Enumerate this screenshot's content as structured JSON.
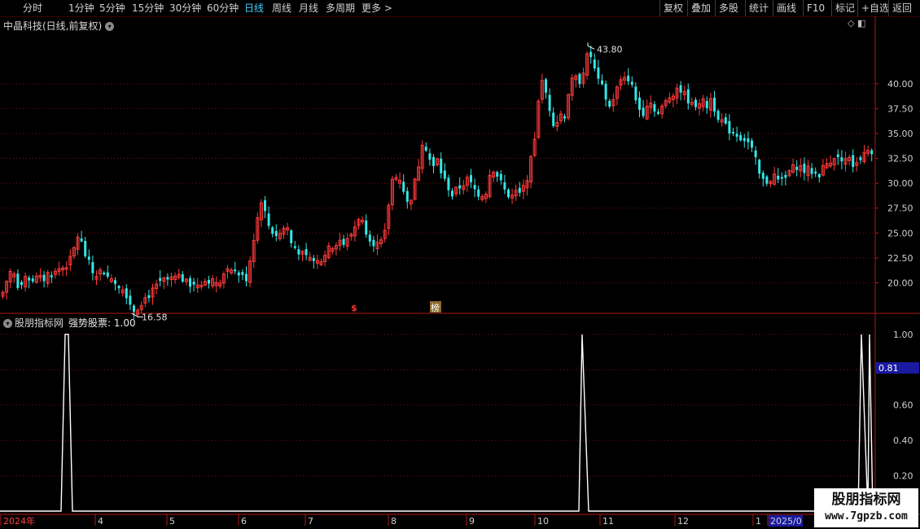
{
  "toolbar": {
    "left": [
      "分时",
      "1分钟",
      "5分钟",
      "15分钟",
      "30分钟",
      "60分钟",
      "日线",
      "周线",
      "月线",
      "多周期",
      "更多 >"
    ],
    "active": "日线",
    "right": [
      "复权",
      "叠加",
      "多股",
      "统计",
      "画线",
      "F10",
      "标记",
      "+自选",
      "返回"
    ]
  },
  "price_panel": {
    "title": "中晶科技(日线,前复权)",
    "max_label": "43.80",
    "min_label": "16.58",
    "marker_dollar": "$",
    "marker_list": "榜"
  },
  "indicator_panel": {
    "name": "股朋指标网",
    "label": "强势股票: 1.00",
    "current_value": "0.81"
  },
  "time_axis": [
    "2024年",
    "4",
    "5",
    "6",
    "7",
    "8",
    "9",
    "10",
    "11",
    "12",
    "1",
    "2025/0"
  ],
  "watermark": {
    "line1": "股朋指标网",
    "line2": "www.7gpzb.com"
  },
  "colors": {
    "up": "#ff3a3a",
    "down": "#34e6e6",
    "grid": "#7a1010",
    "axis": "#b01818",
    "highlight_box": "#1a1aa0"
  },
  "chart_data": [
    {
      "type": "candlestick",
      "title": "中晶科技(日线,前复权)",
      "ylim": [
        17.5,
        45.3
      ],
      "yticks": [
        20.0,
        22.5,
        25.0,
        27.5,
        30.0,
        32.5,
        35.0,
        37.5,
        40.0
      ],
      "x": [
        "2024年",
        "4",
        "5",
        "6",
        "7",
        "8",
        "9",
        "10",
        "11",
        "12",
        "1",
        "2025/0"
      ],
      "close_path": [
        [
          0,
          18.6
        ],
        [
          4,
          19.5
        ],
        [
          9,
          20.8
        ],
        [
          14,
          21.4
        ],
        [
          19,
          19.6
        ],
        [
          24,
          20.1
        ],
        [
          30,
          20.3
        ],
        [
          36,
          20.0
        ],
        [
          44,
          20.5
        ],
        [
          52,
          20.3
        ],
        [
          58,
          21.0
        ],
        [
          64,
          20.8
        ],
        [
          70,
          21.4
        ],
        [
          78,
          21.6
        ],
        [
          86,
          22.4
        ],
        [
          92,
          24.2
        ],
        [
          96,
          25.2
        ],
        [
          100,
          23.3
        ],
        [
          106,
          22.3
        ],
        [
          112,
          21.0
        ],
        [
          118,
          20.8
        ],
        [
          124,
          21.4
        ],
        [
          130,
          20.6
        ],
        [
          136,
          20.4
        ],
        [
          142,
          19.8
        ],
        [
          150,
          19.6
        ],
        [
          156,
          18.4
        ],
        [
          162,
          17.2
        ],
        [
          168,
          17.6
        ],
        [
          174,
          18.3
        ],
        [
          182,
          18.8
        ],
        [
          190,
          19.5
        ],
        [
          198,
          20.2
        ],
        [
          206,
          20.3
        ],
        [
          214,
          20.5
        ],
        [
          222,
          20.4
        ],
        [
          230,
          19.8
        ],
        [
          238,
          20.0
        ],
        [
          246,
          20.1
        ],
        [
          254,
          20.3
        ],
        [
          262,
          20.0
        ],
        [
          270,
          20.4
        ],
        [
          278,
          21.1
        ],
        [
          286,
          21.0
        ],
        [
          294,
          20.8
        ],
        [
          302,
          20.4
        ],
        [
          308,
          23.6
        ],
        [
          314,
          26.2
        ],
        [
          320,
          28.6
        ],
        [
          326,
          26.2
        ],
        [
          332,
          25.2
        ],
        [
          338,
          24.8
        ],
        [
          344,
          25.0
        ],
        [
          350,
          26.0
        ],
        [
          356,
          24.0
        ],
        [
          362,
          23.4
        ],
        [
          368,
          23.0
        ],
        [
          374,
          22.4
        ],
        [
          380,
          22.2
        ],
        [
          386,
          22.0
        ],
        [
          392,
          22.4
        ],
        [
          398,
          23.0
        ],
        [
          404,
          23.5
        ],
        [
          410,
          24.0
        ],
        [
          416,
          24.3
        ],
        [
          422,
          23.8
        ],
        [
          428,
          24.6
        ],
        [
          434,
          25.6
        ],
        [
          440,
          26.8
        ],
        [
          446,
          25.6
        ],
        [
          452,
          24.6
        ],
        [
          458,
          24.0
        ],
        [
          464,
          23.8
        ],
        [
          470,
          24.2
        ],
        [
          476,
          28.0
        ],
        [
          482,
          31.2
        ],
        [
          488,
          30.6
        ],
        [
          494,
          29.4
        ],
        [
          500,
          27.6
        ],
        [
          506,
          29.4
        ],
        [
          512,
          31.6
        ],
        [
          518,
          34.6
        ],
        [
          524,
          33.0
        ],
        [
          530,
          31.4
        ],
        [
          536,
          32.4
        ],
        [
          542,
          30.6
        ],
        [
          548,
          29.8
        ],
        [
          554,
          28.8
        ],
        [
          560,
          29.4
        ],
        [
          566,
          29.8
        ],
        [
          572,
          30.4
        ],
        [
          578,
          29.8
        ],
        [
          584,
          29.0
        ],
        [
          590,
          28.9
        ],
        [
          596,
          29.2
        ],
        [
          602,
          31.8
        ],
        [
          608,
          31.0
        ],
        [
          614,
          30.0
        ],
        [
          620,
          29.0
        ],
        [
          626,
          28.6
        ],
        [
          632,
          29.0
        ],
        [
          638,
          28.8
        ],
        [
          644,
          30.0
        ],
        [
          650,
          32.0
        ],
        [
          656,
          35.0
        ],
        [
          662,
          40.5
        ],
        [
          668,
          39.4
        ],
        [
          674,
          37.4
        ],
        [
          680,
          35.6
        ],
        [
          686,
          37.0
        ],
        [
          692,
          36.8
        ],
        [
          698,
          39.8
        ],
        [
          704,
          40.6
        ],
        [
          710,
          40.2
        ],
        [
          716,
          41.6
        ],
        [
          722,
          43.4
        ],
        [
          728,
          41.6
        ],
        [
          734,
          40.0
        ],
        [
          740,
          39.4
        ],
        [
          746,
          37.4
        ],
        [
          752,
          38.6
        ],
        [
          758,
          39.8
        ],
        [
          764,
          41.0
        ],
        [
          770,
          40.6
        ],
        [
          776,
          39.4
        ],
        [
          782,
          37.6
        ],
        [
          788,
          37.0
        ],
        [
          794,
          38.2
        ],
        [
          800,
          38.0
        ],
        [
          806,
          36.8
        ],
        [
          812,
          37.6
        ],
        [
          818,
          38.4
        ],
        [
          824,
          39.0
        ],
        [
          830,
          39.6
        ],
        [
          836,
          39.2
        ],
        [
          842,
          38.6
        ],
        [
          848,
          37.8
        ],
        [
          854,
          38.0
        ],
        [
          860,
          38.4
        ],
        [
          866,
          37.6
        ],
        [
          872,
          38.6
        ],
        [
          878,
          37.0
        ],
        [
          884,
          36.4
        ],
        [
          890,
          35.6
        ],
        [
          896,
          35.2
        ],
        [
          902,
          35.0
        ],
        [
          908,
          34.6
        ],
        [
          914,
          34.4
        ],
        [
          920,
          33.8
        ],
        [
          926,
          32.4
        ],
        [
          932,
          30.6
        ],
        [
          938,
          30.0
        ],
        [
          944,
          30.4
        ],
        [
          950,
          30.8
        ],
        [
          956,
          30.0
        ],
        [
          962,
          30.6
        ],
        [
          968,
          31.2
        ],
        [
          974,
          31.6
        ],
        [
          980,
          31.8
        ],
        [
          986,
          31.2
        ],
        [
          992,
          31.4
        ],
        [
          998,
          31.0
        ],
        [
          1004,
          30.8
        ],
        [
          1010,
          31.6
        ],
        [
          1016,
          32.2
        ],
        [
          1022,
          32.6
        ],
        [
          1028,
          32.8
        ],
        [
          1034,
          32.4
        ],
        [
          1040,
          32.6
        ],
        [
          1046,
          31.8
        ],
        [
          1052,
          32.4
        ],
        [
          1058,
          32.8
        ],
        [
          1064,
          33.0
        ],
        [
          1070,
          32.6
        ]
      ]
    },
    {
      "type": "line",
      "title": "股朋指标网 强势股票: 1.00",
      "ylim": [
        0,
        1.05
      ],
      "yticks": [
        0.2,
        0.4,
        0.6,
        0.8,
        1.0
      ],
      "series": [
        {
          "name": "强势股票",
          "values": [
            0,
            0,
            1,
            1,
            0,
            0,
            1,
            0,
            0,
            1,
            1
          ]
        }
      ],
      "spike_positions": [
        80,
        84,
        715,
        719,
        1058,
        1062,
        1071
      ],
      "current_value": 0.81
    }
  ]
}
